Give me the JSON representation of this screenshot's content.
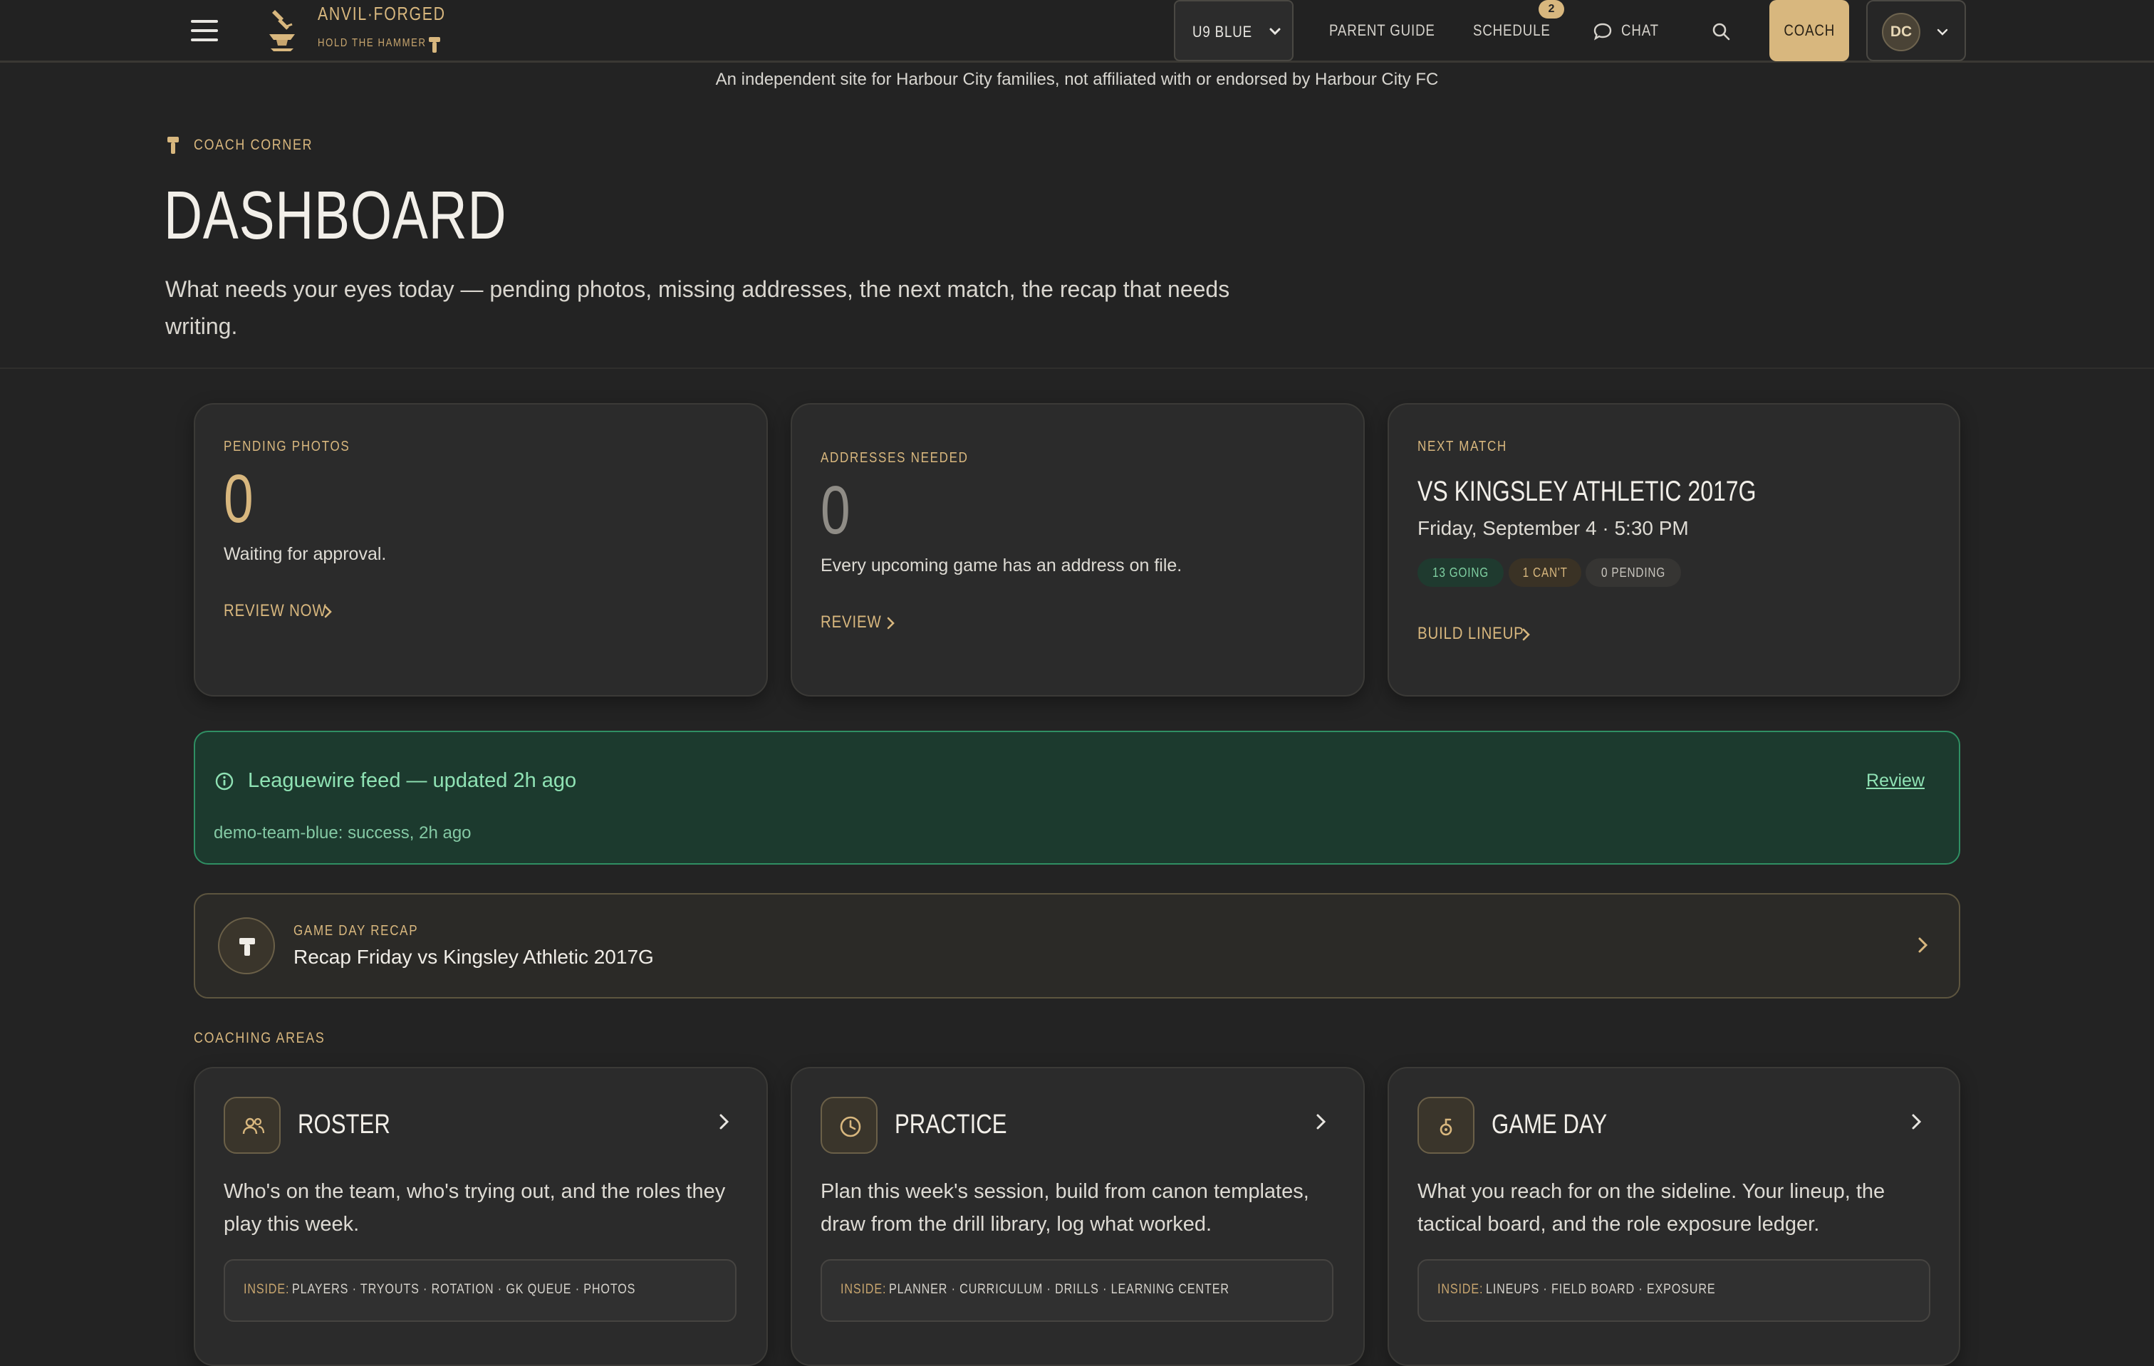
{
  "brand": {
    "name": "ANVIL·FORGED",
    "tagline": "HOLD THE HAMMER"
  },
  "header": {
    "team_select": "U9 BLUE",
    "nav": [
      {
        "label": "PARENT GUIDE"
      },
      {
        "label": "SCHEDULE",
        "badge": "2"
      },
      {
        "label": "CHAT"
      }
    ],
    "coach_label": "COACH",
    "avatar_initials": "DC"
  },
  "disclaimer": "An independent site for Harbour City families, not affiliated with or endorsed by Harbour City FC",
  "hero": {
    "eyebrow": "COACH CORNER",
    "title": "DASHBOARD",
    "subtitle": "What needs your eyes today — pending photos, missing addresses, the next match, the recap that needs writing."
  },
  "stats": {
    "photos": {
      "label": "PENDING PHOTOS",
      "value": "0",
      "desc": "Waiting for approval.",
      "link": "REVIEW NOW"
    },
    "addresses": {
      "label": "ADDRESSES NEEDED",
      "value": "0",
      "desc": "Every upcoming game has an address on file.",
      "link": "REVIEW"
    },
    "match": {
      "label": "NEXT MATCH",
      "title": "VS KINGSLEY ATHLETIC 2017G",
      "when": "Friday, September 4 · 5:30 PM",
      "going": "13 GOING",
      "cant": "1 CAN'T",
      "pending": "0 PENDING",
      "link": "BUILD LINEUP"
    }
  },
  "feed": {
    "title": "Leaguewire feed — updated 2h ago",
    "review": "Review",
    "sub": "demo-team-blue: success, 2h ago"
  },
  "recap": {
    "label": "GAME DAY RECAP",
    "title": "Recap Friday vs Kingsley Athletic 2017G"
  },
  "areas_label": "COACHING AREAS",
  "areas": [
    {
      "title": "ROSTER",
      "desc": "Who's on the team, who's trying out, and the roles they play this week.",
      "inside_label": "INSIDE:",
      "inside": "PLAYERS · TRYOUTS · ROTATION · GK QUEUE · PHOTOS"
    },
    {
      "title": "PRACTICE",
      "desc": "Plan this week's session, build from canon templates, draw from the drill library, log what worked.",
      "inside_label": "INSIDE:",
      "inside": "PLANNER · CURRICULUM · DRILLS · LEARNING CENTER"
    },
    {
      "title": "GAME DAY",
      "desc": "What you reach for on the sideline. Your lineup, the tactical board, and the role exposure ledger.",
      "inside_label": "INSIDE:",
      "inside": "LINEUPS · FIELD BOARD · EXPOSURE"
    }
  ],
  "colors": {
    "accent": "#d8b77e",
    "background": "#232323",
    "success": "#2f8f63"
  }
}
